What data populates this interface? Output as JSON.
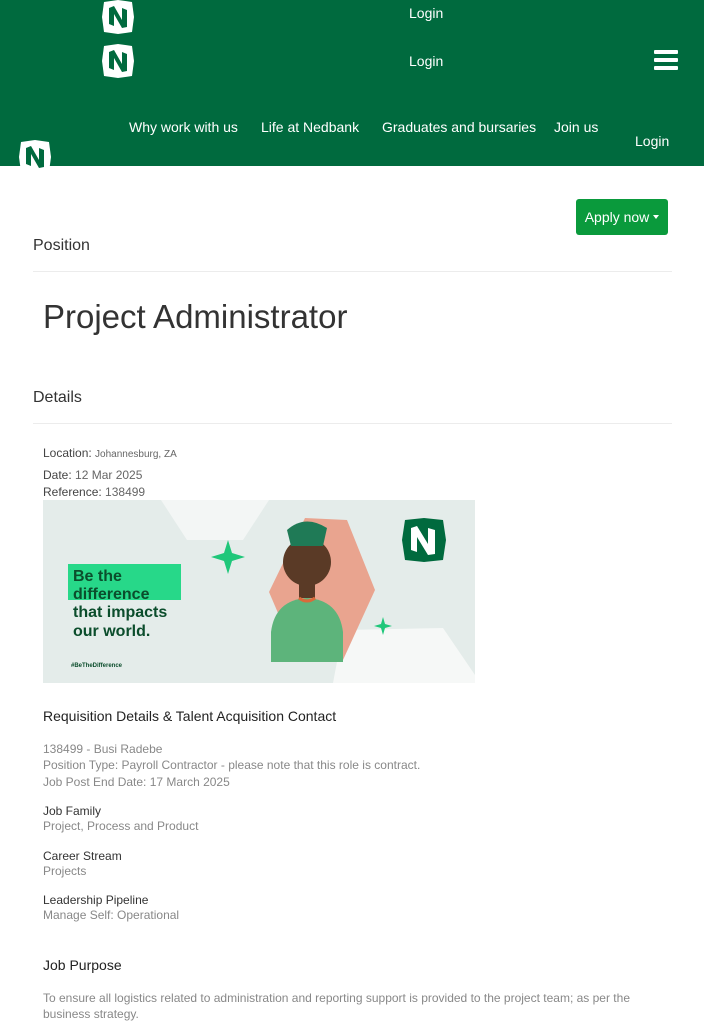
{
  "header": {
    "login_1": "Login",
    "login_2": "Login",
    "login_3": "Login",
    "nav": [
      "Why work with us",
      "Life at Nedbank",
      "Graduates and bursaries",
      "Join us"
    ],
    "brand_color": "#006a3e"
  },
  "apply_button": {
    "label": "Apply now"
  },
  "position_heading": "Position",
  "job_title": "Project Administrator",
  "details_heading": "Details",
  "details": {
    "location_label": "Location:",
    "location_value": "Johannesburg, ZA",
    "date_label": "Date:",
    "date_value": "12 Mar 2025",
    "reference_label": "Reference:",
    "reference_value": "138499"
  },
  "banner": {
    "line1": "Be the",
    "line2": "difference",
    "line3": "that impacts",
    "line4": "our world.",
    "hashtag": "#BeTheDifference"
  },
  "requisition": {
    "heading": "Requisition Details & Talent Acquisition Contact",
    "line1": "138499 - Busi Radebe",
    "line2": "Position Type: Payroll Contractor - please note that this role is contract.",
    "line3": "Job Post End Date: 17 March 2025"
  },
  "job_family": {
    "label": "Job Family",
    "value": "Project, Process and Product"
  },
  "career_stream": {
    "label": "Career Stream",
    "value": "Projects"
  },
  "leadership_pipeline": {
    "label": "Leadership Pipeline",
    "value": "Manage Self: Operational"
  },
  "job_purpose": {
    "heading": "Job Purpose",
    "text": "To ensure all logistics related to administration and reporting support is provided to the project team; as per the business strategy."
  }
}
